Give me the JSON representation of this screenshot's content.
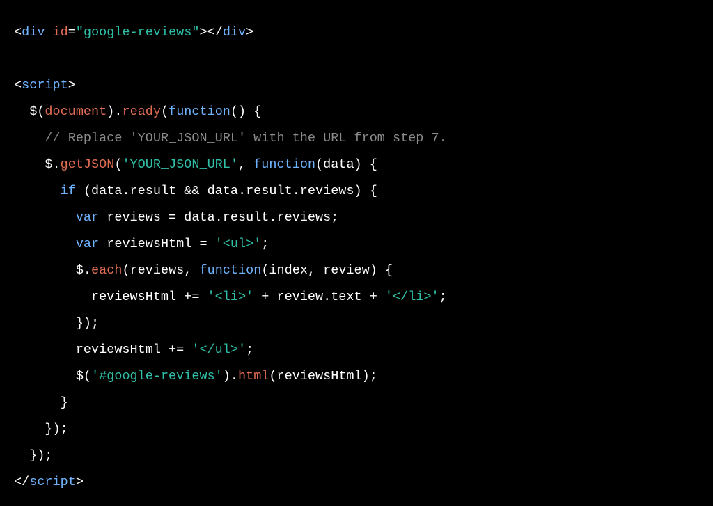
{
  "code": {
    "lines": [
      [
        {
          "t": "<",
          "c": "white"
        },
        {
          "t": "div",
          "c": "blue"
        },
        {
          "t": " ",
          "c": "white"
        },
        {
          "t": "id",
          "c": "orange"
        },
        {
          "t": "=",
          "c": "white"
        },
        {
          "t": "\"google-reviews\"",
          "c": "teal"
        },
        {
          "t": "></",
          "c": "white"
        },
        {
          "t": "div",
          "c": "blue"
        },
        {
          "t": ">",
          "c": "white"
        }
      ],
      [
        {
          "t": "",
          "c": "white"
        }
      ],
      [
        {
          "t": "<",
          "c": "white"
        },
        {
          "t": "script",
          "c": "blue"
        },
        {
          "t": ">",
          "c": "white"
        }
      ],
      [
        {
          "t": "  $(",
          "c": "white"
        },
        {
          "t": "document",
          "c": "orange"
        },
        {
          "t": ").",
          "c": "white"
        },
        {
          "t": "ready",
          "c": "orange"
        },
        {
          "t": "(",
          "c": "white"
        },
        {
          "t": "function",
          "c": "blue"
        },
        {
          "t": "() {",
          "c": "white"
        }
      ],
      [
        {
          "t": "    ",
          "c": "white"
        },
        {
          "t": "// Replace 'YOUR_JSON_URL' with the URL from step 7.",
          "c": "gray"
        }
      ],
      [
        {
          "t": "    $.",
          "c": "white"
        },
        {
          "t": "getJSON",
          "c": "orange"
        },
        {
          "t": "(",
          "c": "white"
        },
        {
          "t": "'YOUR_JSON_URL'",
          "c": "teal"
        },
        {
          "t": ", ",
          "c": "white"
        },
        {
          "t": "function",
          "c": "blue"
        },
        {
          "t": "(data) {",
          "c": "white"
        }
      ],
      [
        {
          "t": "      ",
          "c": "white"
        },
        {
          "t": "if",
          "c": "blue"
        },
        {
          "t": " (data.result && data.result.reviews) {",
          "c": "white"
        }
      ],
      [
        {
          "t": "        ",
          "c": "white"
        },
        {
          "t": "var",
          "c": "blue"
        },
        {
          "t": " reviews = data.result.reviews;",
          "c": "white"
        }
      ],
      [
        {
          "t": "        ",
          "c": "white"
        },
        {
          "t": "var",
          "c": "blue"
        },
        {
          "t": " reviewsHtml = ",
          "c": "white"
        },
        {
          "t": "'<ul>'",
          "c": "teal"
        },
        {
          "t": ";",
          "c": "white"
        }
      ],
      [
        {
          "t": "        $.",
          "c": "white"
        },
        {
          "t": "each",
          "c": "orange"
        },
        {
          "t": "(reviews, ",
          "c": "white"
        },
        {
          "t": "function",
          "c": "blue"
        },
        {
          "t": "(index, review) {",
          "c": "white"
        }
      ],
      [
        {
          "t": "          reviewsHtml += ",
          "c": "white"
        },
        {
          "t": "'<li>'",
          "c": "teal"
        },
        {
          "t": " + review.text + ",
          "c": "white"
        },
        {
          "t": "'</li>'",
          "c": "teal"
        },
        {
          "t": ";",
          "c": "white"
        }
      ],
      [
        {
          "t": "        });",
          "c": "white"
        }
      ],
      [
        {
          "t": "        reviewsHtml += ",
          "c": "white"
        },
        {
          "t": "'</ul>'",
          "c": "teal"
        },
        {
          "t": ";",
          "c": "white"
        }
      ],
      [
        {
          "t": "        $(",
          "c": "white"
        },
        {
          "t": "'#google-reviews'",
          "c": "teal"
        },
        {
          "t": ").",
          "c": "white"
        },
        {
          "t": "html",
          "c": "orange"
        },
        {
          "t": "(reviewsHtml);",
          "c": "white"
        }
      ],
      [
        {
          "t": "      }",
          "c": "white"
        }
      ],
      [
        {
          "t": "    });",
          "c": "white"
        }
      ],
      [
        {
          "t": "  });",
          "c": "white"
        }
      ],
      [
        {
          "t": "</",
          "c": "white"
        },
        {
          "t": "script",
          "c": "blue"
        },
        {
          "t": ">",
          "c": "white"
        }
      ]
    ]
  }
}
